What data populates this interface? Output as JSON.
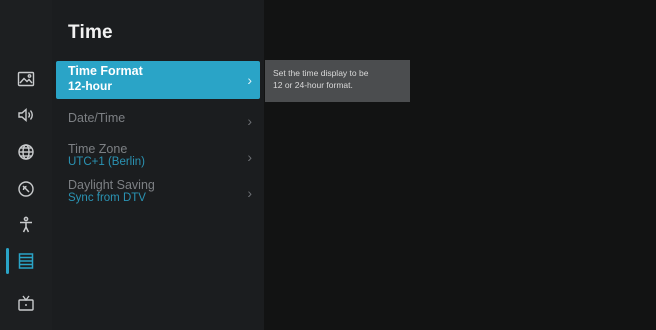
{
  "panel": {
    "title": "Time",
    "items": [
      {
        "label": "Time Format",
        "value": "12-hour",
        "selected": true
      },
      {
        "label": "Date/Time",
        "value": "",
        "selected": false
      },
      {
        "label": "Time Zone",
        "value": "UTC+1 (Berlin)",
        "selected": false
      },
      {
        "label": "Daylight Saving",
        "value": "Sync from DTV",
        "selected": false
      }
    ]
  },
  "tooltip": {
    "line1": "Set the time display to be",
    "line2": "12 or 24-hour format."
  },
  "rail": {
    "icons": [
      "picture-icon",
      "sound-icon",
      "network-icon",
      "remote-control-icon",
      "accessibility-icon",
      "system-menu-icon",
      "tv-antenna-icon"
    ],
    "active_icon": "system-menu-icon"
  },
  "colors": {
    "accent": "#2aa4c7",
    "panel_bg": "#1b1d1f",
    "rail_bg": "#1d1f21",
    "tooltip_bg": "#4b4d4f"
  }
}
